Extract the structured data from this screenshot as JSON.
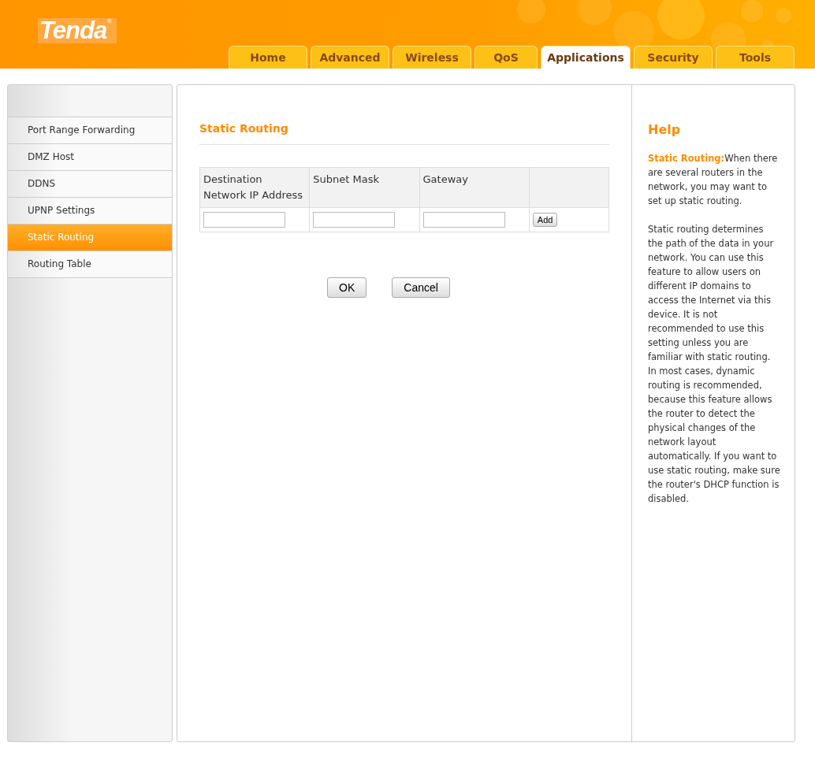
{
  "header": {
    "logo": "Tenda",
    "logo_mark": "®"
  },
  "tabs": [
    {
      "label": "Home",
      "selected": false
    },
    {
      "label": "Advanced",
      "selected": false
    },
    {
      "label": "Wireless",
      "selected": false
    },
    {
      "label": "QoS",
      "selected": false
    },
    {
      "label": "Applications",
      "selected": true
    },
    {
      "label": "Security",
      "selected": false
    },
    {
      "label": "Tools",
      "selected": false
    }
  ],
  "sidebar": {
    "items": [
      {
        "label": "Port Range Forwarding",
        "selected": false
      },
      {
        "label": "DMZ Host",
        "selected": false
      },
      {
        "label": "DDNS",
        "selected": false
      },
      {
        "label": "UPNP Settings",
        "selected": false
      },
      {
        "label": "Static Routing",
        "selected": true
      },
      {
        "label": "Routing Table",
        "selected": false
      }
    ]
  },
  "main": {
    "title": "Static Routing",
    "table": {
      "columns": [
        "Destination Network IP Address",
        "Subnet Mask",
        "Gateway"
      ],
      "add_button": "Add"
    },
    "buttons": [
      "OK",
      "Cancel"
    ]
  },
  "help": {
    "title": "Help",
    "paragraphs": [
      "**Static Routing:**When there are several routers in the network, you may want to set up static routing.",
      "Static routing determines the path of the data in your network. You can use this feature to allow users on different IP domains to access the Internet via this device. It is not recommended to use this setting unless you are familiar with static routing. In most cases, dynamic routing is recommended, because this feature allows the router to detect the physical changes of the network layout automatically. If you want to use static routing, make sure the router's DHCP function is disabled."
    ]
  }
}
